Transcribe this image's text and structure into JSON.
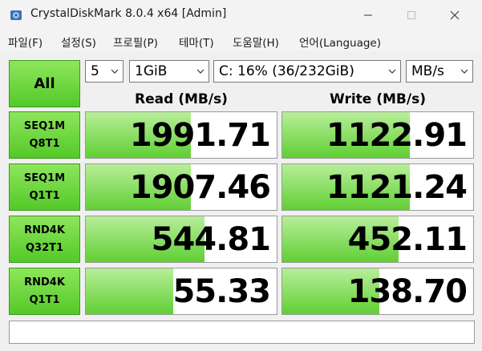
{
  "window": {
    "title": "CrystalDiskMark 8.0.4 x64 [Admin]"
  },
  "menu": [
    {
      "label": "파일(F)"
    },
    {
      "label": "설정(S)"
    },
    {
      "label": "프로필(P)"
    },
    {
      "label": "테마(T)"
    },
    {
      "label": "도움말(H)"
    },
    {
      "label": "언어(Language)"
    }
  ],
  "controls": {
    "all_label": "All",
    "count": "5",
    "size": "1GiB",
    "drive": "C: 16% (36/232GiB)",
    "unit": "MB/s"
  },
  "headers": {
    "read": "Read (MB/s)",
    "write": "Write (MB/s)"
  },
  "rows": [
    {
      "line1": "SEQ1M",
      "line2": "Q8T1",
      "read": "1991.71",
      "write": "1122.91",
      "read_fill": 0.55,
      "write_fill": 0.67
    },
    {
      "line1": "SEQ1M",
      "line2": "Q1T1",
      "read": "1907.46",
      "write": "1121.24",
      "read_fill": 0.55,
      "write_fill": 0.67
    },
    {
      "line1": "RND4K",
      "line2": "Q32T1",
      "read": "544.81",
      "write": "452.11",
      "read_fill": 0.62,
      "write_fill": 0.61
    },
    {
      "line1": "RND4K",
      "line2": "Q1T1",
      "read": "55.33",
      "write": "138.70",
      "read_fill": 0.46,
      "write_fill": 0.51
    }
  ],
  "comment": "",
  "colors": {
    "accent_green": "#53c928",
    "bar_green": "#61cf34",
    "background": "#f0f0f0"
  },
  "icons": {
    "app": "disk-icon",
    "minimize": "minimize-icon",
    "maximize": "maximize-icon",
    "close": "close-icon",
    "dropdown": "chevron-down-icon"
  }
}
